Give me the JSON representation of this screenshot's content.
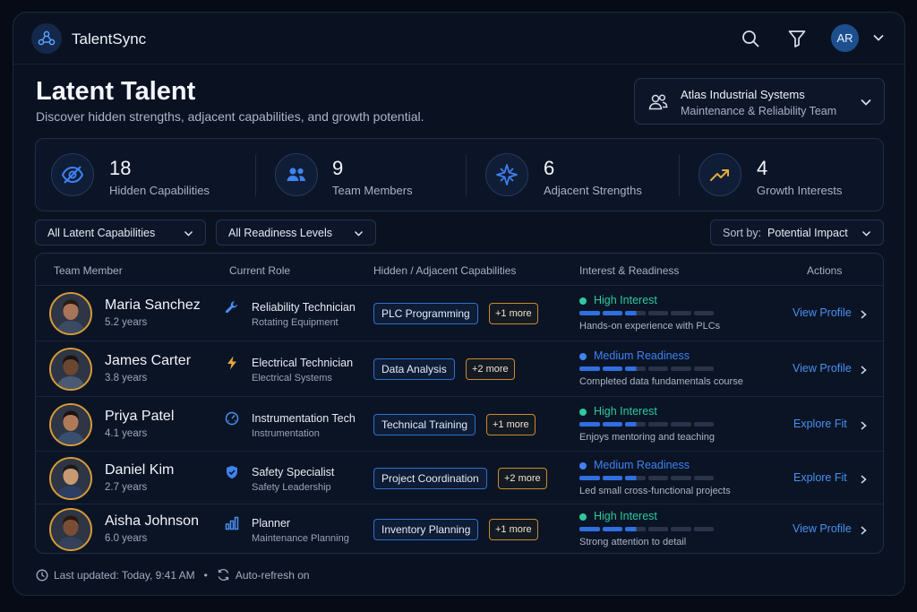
{
  "app": {
    "name": "TalentSync",
    "user_initials": "AR"
  },
  "page": {
    "title": "Latent Talent",
    "subtitle": "Discover hidden strengths, adjacent capabilities, and growth potential."
  },
  "org": {
    "name": "Atlas Industrial Systems",
    "team": "Maintenance & Reliability Team"
  },
  "stats": [
    {
      "value": "18",
      "label": "Hidden Capabilities",
      "icon": "eye-off-icon"
    },
    {
      "value": "9",
      "label": "Team Members",
      "icon": "users-icon"
    },
    {
      "value": "6",
      "label": "Adjacent Strengths",
      "icon": "compass-star-icon"
    },
    {
      "value": "4",
      "label": "Growth Interests",
      "icon": "trend-up-icon"
    }
  ],
  "filters": {
    "capabilities": "All Latent Capabilities",
    "readiness": "All Readiness Levels",
    "sort_prefix": "Sort by:",
    "sort_value": "Potential Impact"
  },
  "table": {
    "headers": [
      "Team Member",
      "Current Role",
      "Hidden / Adjacent Capabilities",
      "Interest & Readiness",
      "Actions"
    ],
    "rows": [
      {
        "name": "Maria Sanchez",
        "years": "5.2 years",
        "role": "Reliability Technician",
        "role_sub": "Rotating Equipment",
        "role_icon": "wrench-icon",
        "capability": "PLC Programming",
        "more": "+1 more",
        "status": "High Interest",
        "status_color": "#2ec9a0",
        "level": 0.45,
        "note": "Hands-on experience with PLCs",
        "action": "View Profile"
      },
      {
        "name": "James Carter",
        "years": "3.8 years",
        "role": "Electrical Technician",
        "role_sub": "Electrical Systems",
        "role_icon": "lightning-icon",
        "capability": "Data Analysis",
        "more": "+2 more",
        "status": "Medium Readiness",
        "status_color": "#3f82f2",
        "level": 0.38,
        "note": "Completed data fundamentals course",
        "action": "View Profile"
      },
      {
        "name": "Priya Patel",
        "years": "4.1 years",
        "role": "Instrumentation Tech",
        "role_sub": "Instrumentation",
        "role_icon": "gauge-icon",
        "capability": "Technical Training",
        "more": "+1 more",
        "status": "High Interest",
        "status_color": "#2ec9a0",
        "level": 0.45,
        "note": "Enjoys mentoring and teaching",
        "action": "Explore Fit"
      },
      {
        "name": "Daniel Kim",
        "years": "2.7 years",
        "role": "Safety Specialist",
        "role_sub": "Safety Leadership",
        "role_icon": "shield-icon",
        "capability": "Project Coordination",
        "more": "+2 more",
        "status": "Medium Readiness",
        "status_color": "#3f82f2",
        "level": 0.38,
        "note": "Led small cross-functional projects",
        "action": "Explore Fit"
      },
      {
        "name": "Aisha Johnson",
        "years": "6.0 years",
        "role": "Planner",
        "role_sub": "Maintenance Planning",
        "role_icon": "bar-chart-icon",
        "capability": "Inventory Planning",
        "more": "+1 more",
        "status": "High Interest",
        "status_color": "#2ec9a0",
        "level": 0.45,
        "note": "Strong attention to detail",
        "action": "View Profile"
      }
    ]
  },
  "footer": {
    "updated": "Last updated: Today, 9:41 AM",
    "separator": "•",
    "refresh": "Auto-refresh on"
  }
}
